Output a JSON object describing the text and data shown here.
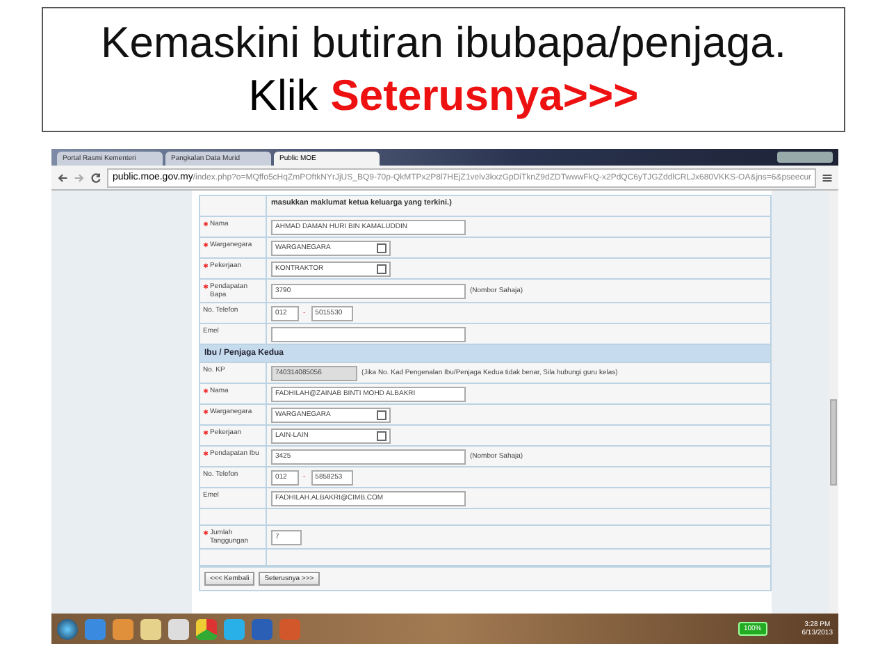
{
  "slide": {
    "title": "Kemaskini butiran ibubapa/penjaga.",
    "instruction": "Klik",
    "highlight": "Seterusnya>>>"
  },
  "browser": {
    "tabs": [
      {
        "label": "Portal Rasmi Kementeri",
        "selected": false
      },
      {
        "label": "Pangkalan Data Murid",
        "selected": false
      },
      {
        "label": "Public MOE",
        "selected": true
      }
    ],
    "url_host": "public.moe.gov.my",
    "url_path": "/index.php?o=MQffo5cHqZmPOftkNYrJjUS_BQ9-70p-QkMTPx2P8l7HEjZ1velv3kxzGpDiTknZ9dZDTwwwFkQ-x2PdQC6yTJGZddlCRLJx680VKKS-OA&jns=6&pseecur"
  },
  "form": {
    "note": "masukkan maklumat ketua keluarga yang terkini.)",
    "rows": [
      {
        "kind": "text",
        "label": "Nama",
        "required": true,
        "value": "AHMAD DAMAN HURI BIN KAMALUDDIN"
      },
      {
        "kind": "select",
        "label": "Warganegara",
        "required": true,
        "value": "WARGANEGARA"
      },
      {
        "kind": "select",
        "label": "Pekerjaan",
        "required": true,
        "value": "KONTRAKTOR"
      },
      {
        "kind": "text",
        "label": "Pendapatan Bapa",
        "required": true,
        "value": "3790",
        "hint": "(Nombor Sahaja)"
      },
      {
        "kind": "phone",
        "label": "No. Telefon",
        "required": false,
        "prefix": "012",
        "separator": "-",
        "value": "5015530"
      },
      {
        "kind": "text",
        "label": "Emel",
        "required": false
      },
      {
        "kind": "section",
        "title": "Ibu / Penjaga Kedua"
      },
      {
        "kind": "readonly",
        "label": "No. KP",
        "required": false,
        "value": "740314085056",
        "hint": "(Jika No. Kad Pengenalan Ibu/Penjaga Kedua tidak benar, Sila hubungi guru kelas)"
      },
      {
        "kind": "text",
        "label": "Nama",
        "required": true,
        "value": "FADHILAH@ZAINAB BINTI MOHD ALBAKRI"
      },
      {
        "kind": "select",
        "label": "Warganegara",
        "required": true,
        "value": "WARGANEGARA"
      },
      {
        "kind": "select",
        "label": "Pekerjaan",
        "required": true,
        "value": "LAIN-LAIN"
      },
      {
        "kind": "text",
        "label": "Pendapatan Ibu",
        "required": true,
        "value": "3425",
        "hint": "(Nombor Sahaja)"
      },
      {
        "kind": "phone",
        "label": "No. Telefon",
        "required": false,
        "prefix": "012",
        "separator": "-",
        "value": "5858253"
      },
      {
        "kind": "text",
        "label": "Emel",
        "required": false,
        "value": "FADHILAH.ALBAKRI@CIMB.COM"
      },
      {
        "kind": "blank"
      },
      {
        "kind": "short",
        "label": "Jumlah Tanggungan",
        "required": true,
        "value": "7"
      },
      {
        "kind": "blank"
      }
    ],
    "buttons": [
      "<<< Kembali",
      "Seterusnya >>>"
    ]
  },
  "taskbar": {
    "battery": "100%",
    "time": "3:28 PM",
    "date": "6/13/2013"
  }
}
